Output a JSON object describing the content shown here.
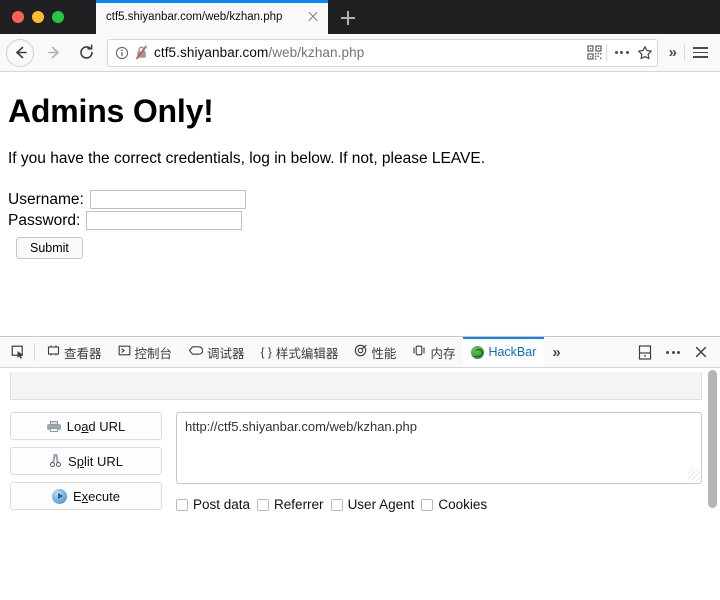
{
  "browser": {
    "window_controls": [
      "close",
      "minimize",
      "maximize"
    ],
    "tab": {
      "title": "ctf5.shiyanbar.com/web/kzhan.php",
      "close_icon": "close-icon"
    },
    "new_tab_label": "+",
    "nav": {
      "back_icon": "arrow-left-icon",
      "forward_icon": "arrow-right-icon",
      "reload_icon": "reload-icon"
    },
    "address_bar": {
      "identity_icon": "info-icon",
      "insecure_icon": "crossed-out-padlock-icon",
      "url_prefix": "ctf5.shiyanbar.com",
      "url_suffix": "/web/kzhan.php",
      "reader_icon": "qr-code-icon",
      "page_actions_icon": "ellipsis-icon",
      "bookmark_icon": "star-icon"
    },
    "overflow_icon": "chevron-double-right-icon",
    "menu_icon": "hamburger-menu-icon",
    "accent_color": "#0a84ff"
  },
  "page": {
    "title": "Admins Only!",
    "description": "If you have the correct credentials, log in below. If not, please LEAVE.",
    "fields": [
      {
        "label": "Username:",
        "value": "",
        "placeholder": ""
      },
      {
        "label": "Password:",
        "value": "",
        "placeholder": ""
      }
    ],
    "submit_label": "Submit"
  },
  "devtools": {
    "picker_icon": "element-picker-icon",
    "tabs": [
      {
        "label": "查看器",
        "icon": "inspector-icon",
        "active": false
      },
      {
        "label": "控制台",
        "icon": "console-icon",
        "active": false
      },
      {
        "label": "调试器",
        "icon": "debugger-icon",
        "active": false
      },
      {
        "label": "样式编辑器",
        "icon": "style-editor-icon",
        "active": false
      },
      {
        "label": "性能",
        "icon": "performance-icon",
        "active": false
      },
      {
        "label": "内存",
        "icon": "memory-icon",
        "active": false
      },
      {
        "label": "HackBar",
        "icon": "hackbar-green-icon",
        "active": true
      }
    ],
    "overflow_icon": "chevron-double-right-icon",
    "dock_icon": "dock-position-icon",
    "meatball_icon": "ellipsis-icon",
    "close_icon": "close-icon",
    "active_tab_color": "#0a6cd4"
  },
  "hackbar": {
    "buttons": [
      {
        "icon": "printer-icon",
        "pre": "Lo",
        "key": "a",
        "post": "d URL"
      },
      {
        "icon": "scissors-icon",
        "pre": "S",
        "key": "p",
        "post": "lit URL"
      },
      {
        "icon": "play-icon",
        "pre": "E",
        "key": "x",
        "post": "ecute"
      }
    ],
    "url_value": "http://ctf5.shiyanbar.com/web/kzhan.php",
    "url_placeholder": "",
    "checkboxes": [
      {
        "label": "Post data",
        "checked": false
      },
      {
        "label": "Referrer",
        "checked": false
      },
      {
        "label": "User Agent",
        "checked": false
      },
      {
        "label": "Cookies",
        "checked": false
      }
    ]
  }
}
